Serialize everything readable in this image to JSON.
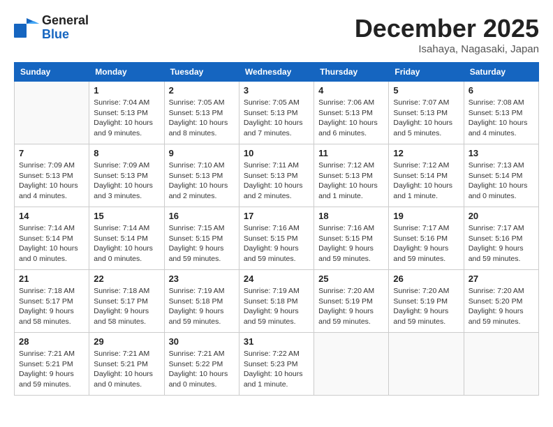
{
  "header": {
    "logo_line1": "General",
    "logo_line2": "Blue",
    "month": "December 2025",
    "location": "Isahaya, Nagasaki, Japan"
  },
  "weekdays": [
    "Sunday",
    "Monday",
    "Tuesday",
    "Wednesday",
    "Thursday",
    "Friday",
    "Saturday"
  ],
  "weeks": [
    [
      {
        "day": "",
        "detail": ""
      },
      {
        "day": "1",
        "detail": "Sunrise: 7:04 AM\nSunset: 5:13 PM\nDaylight: 10 hours\nand 9 minutes."
      },
      {
        "day": "2",
        "detail": "Sunrise: 7:05 AM\nSunset: 5:13 PM\nDaylight: 10 hours\nand 8 minutes."
      },
      {
        "day": "3",
        "detail": "Sunrise: 7:05 AM\nSunset: 5:13 PM\nDaylight: 10 hours\nand 7 minutes."
      },
      {
        "day": "4",
        "detail": "Sunrise: 7:06 AM\nSunset: 5:13 PM\nDaylight: 10 hours\nand 6 minutes."
      },
      {
        "day": "5",
        "detail": "Sunrise: 7:07 AM\nSunset: 5:13 PM\nDaylight: 10 hours\nand 5 minutes."
      },
      {
        "day": "6",
        "detail": "Sunrise: 7:08 AM\nSunset: 5:13 PM\nDaylight: 10 hours\nand 4 minutes."
      }
    ],
    [
      {
        "day": "7",
        "detail": "Sunrise: 7:09 AM\nSunset: 5:13 PM\nDaylight: 10 hours\nand 4 minutes."
      },
      {
        "day": "8",
        "detail": "Sunrise: 7:09 AM\nSunset: 5:13 PM\nDaylight: 10 hours\nand 3 minutes."
      },
      {
        "day": "9",
        "detail": "Sunrise: 7:10 AM\nSunset: 5:13 PM\nDaylight: 10 hours\nand 2 minutes."
      },
      {
        "day": "10",
        "detail": "Sunrise: 7:11 AM\nSunset: 5:13 PM\nDaylight: 10 hours\nand 2 minutes."
      },
      {
        "day": "11",
        "detail": "Sunrise: 7:12 AM\nSunset: 5:13 PM\nDaylight: 10 hours\nand 1 minute."
      },
      {
        "day": "12",
        "detail": "Sunrise: 7:12 AM\nSunset: 5:14 PM\nDaylight: 10 hours\nand 1 minute."
      },
      {
        "day": "13",
        "detail": "Sunrise: 7:13 AM\nSunset: 5:14 PM\nDaylight: 10 hours\nand 0 minutes."
      }
    ],
    [
      {
        "day": "14",
        "detail": "Sunrise: 7:14 AM\nSunset: 5:14 PM\nDaylight: 10 hours\nand 0 minutes."
      },
      {
        "day": "15",
        "detail": "Sunrise: 7:14 AM\nSunset: 5:14 PM\nDaylight: 10 hours\nand 0 minutes."
      },
      {
        "day": "16",
        "detail": "Sunrise: 7:15 AM\nSunset: 5:15 PM\nDaylight: 9 hours\nand 59 minutes."
      },
      {
        "day": "17",
        "detail": "Sunrise: 7:16 AM\nSunset: 5:15 PM\nDaylight: 9 hours\nand 59 minutes."
      },
      {
        "day": "18",
        "detail": "Sunrise: 7:16 AM\nSunset: 5:15 PM\nDaylight: 9 hours\nand 59 minutes."
      },
      {
        "day": "19",
        "detail": "Sunrise: 7:17 AM\nSunset: 5:16 PM\nDaylight: 9 hours\nand 59 minutes."
      },
      {
        "day": "20",
        "detail": "Sunrise: 7:17 AM\nSunset: 5:16 PM\nDaylight: 9 hours\nand 59 minutes."
      }
    ],
    [
      {
        "day": "21",
        "detail": "Sunrise: 7:18 AM\nSunset: 5:17 PM\nDaylight: 9 hours\nand 58 minutes."
      },
      {
        "day": "22",
        "detail": "Sunrise: 7:18 AM\nSunset: 5:17 PM\nDaylight: 9 hours\nand 58 minutes."
      },
      {
        "day": "23",
        "detail": "Sunrise: 7:19 AM\nSunset: 5:18 PM\nDaylight: 9 hours\nand 59 minutes."
      },
      {
        "day": "24",
        "detail": "Sunrise: 7:19 AM\nSunset: 5:18 PM\nDaylight: 9 hours\nand 59 minutes."
      },
      {
        "day": "25",
        "detail": "Sunrise: 7:20 AM\nSunset: 5:19 PM\nDaylight: 9 hours\nand 59 minutes."
      },
      {
        "day": "26",
        "detail": "Sunrise: 7:20 AM\nSunset: 5:19 PM\nDaylight: 9 hours\nand 59 minutes."
      },
      {
        "day": "27",
        "detail": "Sunrise: 7:20 AM\nSunset: 5:20 PM\nDaylight: 9 hours\nand 59 minutes."
      }
    ],
    [
      {
        "day": "28",
        "detail": "Sunrise: 7:21 AM\nSunset: 5:21 PM\nDaylight: 9 hours\nand 59 minutes."
      },
      {
        "day": "29",
        "detail": "Sunrise: 7:21 AM\nSunset: 5:21 PM\nDaylight: 10 hours\nand 0 minutes."
      },
      {
        "day": "30",
        "detail": "Sunrise: 7:21 AM\nSunset: 5:22 PM\nDaylight: 10 hours\nand 0 minutes."
      },
      {
        "day": "31",
        "detail": "Sunrise: 7:22 AM\nSunset: 5:23 PM\nDaylight: 10 hours\nand 1 minute."
      },
      {
        "day": "",
        "detail": ""
      },
      {
        "day": "",
        "detail": ""
      },
      {
        "day": "",
        "detail": ""
      }
    ]
  ]
}
